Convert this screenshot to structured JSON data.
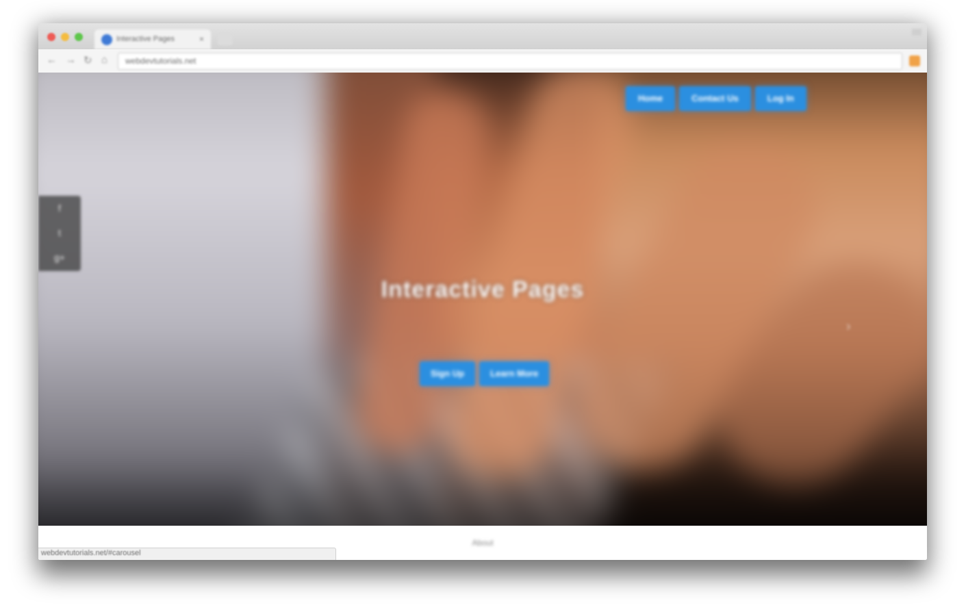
{
  "browser": {
    "tab_title": "Interactive Pages",
    "tab_close": "×",
    "url": "webdevtutorials.net",
    "status_url": "webdevtutorials.net/#carousel"
  },
  "icons": {
    "back": "back-arrow-icon",
    "forward": "forward-arrow-icon",
    "reload": "reload-icon",
    "home": "home-icon",
    "favicon": "favicon-icon",
    "extension": "extension-icon"
  },
  "nav": {
    "items": [
      {
        "label": "Home"
      },
      {
        "label": "Contact Us"
      },
      {
        "label": "Log In"
      }
    ]
  },
  "hero": {
    "title": "Interactive Pages",
    "body": "",
    "ctas": [
      {
        "label": "Sign Up"
      },
      {
        "label": "Learn More"
      }
    ]
  },
  "below": {
    "label": "About"
  },
  "colors": {
    "accent": "#2b8fe0",
    "hero_dark": "#0a0706"
  }
}
